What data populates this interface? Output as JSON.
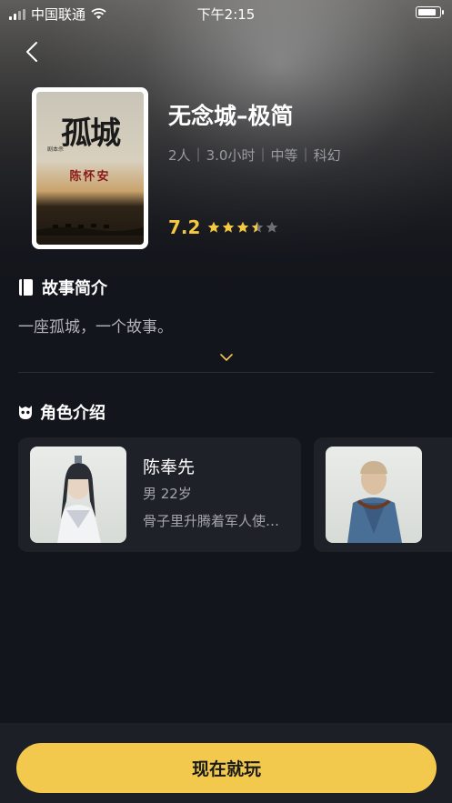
{
  "status_bar": {
    "carrier": "中国联通",
    "time": "下午2:15",
    "battery_level": 0.95
  },
  "header": {
    "back_icon": "chevron-left-icon"
  },
  "game": {
    "title": "无念城–极简",
    "meta": [
      "2人",
      "3.0小时",
      "中等",
      "科幻"
    ],
    "rating": "7.2",
    "stars": 3.5,
    "cover": {
      "title": "孤城",
      "author": "陈怀安",
      "sub": "剧本杀"
    }
  },
  "synopsis": {
    "section_title": "故事简介",
    "icon": "book-icon",
    "text": "一座孤城，一个故事。",
    "expand_icon": "chevron-down-icon"
  },
  "characters": {
    "section_title": "角色介绍",
    "icon": "mask-icon",
    "items": [
      {
        "name": "陈奉先",
        "info": "男  22岁",
        "desc": "骨子里升腾着军人使…"
      },
      {
        "name": "",
        "info": "",
        "desc": ""
      }
    ]
  },
  "footer": {
    "play_label": "现在就玩"
  },
  "colors": {
    "accent": "#f2c94c",
    "rating": "#f5c842",
    "background": "#13151c",
    "card": "#1f2129"
  }
}
